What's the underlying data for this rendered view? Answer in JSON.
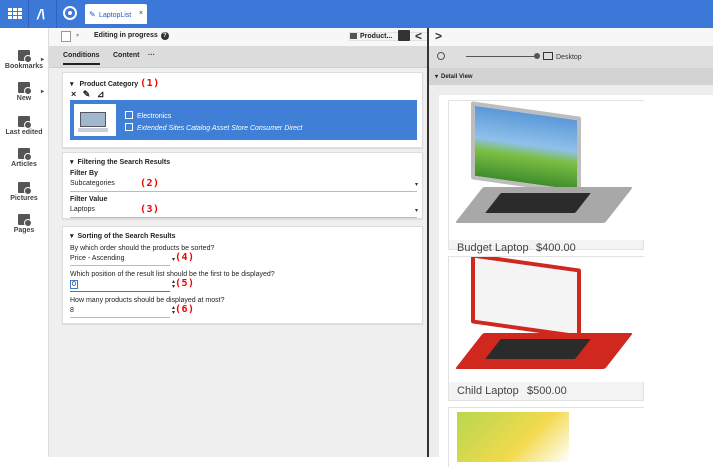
{
  "topbar": {
    "tab_label": "LaptopList",
    "tab_close": "×",
    "bg_color": "#3c78d8"
  },
  "sidebar": {
    "items": [
      {
        "label": "Bookmarks",
        "icon": "bookmarks-icon",
        "has_submenu": true
      },
      {
        "label": "New",
        "icon": "new-icon",
        "has_submenu": true
      },
      {
        "label": "Last edited",
        "icon": "last-edited-icon"
      },
      {
        "label": "Articles",
        "icon": "articles-icon"
      },
      {
        "label": "Pictures",
        "icon": "pictures-icon"
      },
      {
        "label": "Pages",
        "icon": "pages-icon"
      }
    ]
  },
  "editor": {
    "status": "Editing in progress",
    "help_glyph": "?",
    "product_button": "Product...",
    "collapse_glyph": "<",
    "tabs": [
      "Conditions",
      "Content",
      "···"
    ],
    "active_tab": "Conditions"
  },
  "product_category": {
    "title": "Product Category",
    "marker": "(1)",
    "actions": [
      "×",
      "✎",
      "⊿"
    ],
    "selected": {
      "name": "Electronics",
      "catalog": "Extended Sites Catalog Asset Store Consumer Direct"
    },
    "selection_color": "#3f7fd6"
  },
  "filtering": {
    "title": "Filtering the Search Results",
    "filter_by_label": "Filter By",
    "filter_by_value": "Subcategories",
    "filter_by_marker": "(2)",
    "filter_value_label": "Filter Value",
    "filter_value_value": "Laptops",
    "filter_value_marker": "(3)"
  },
  "sorting": {
    "title": "Sorting of the Search Results",
    "order_question": "By which order should the products be sorted?",
    "order_value": "Price - Ascending",
    "order_marker": "(4)",
    "position_question": "Which position of the result list should be the first to be displayed?",
    "position_value": "0",
    "position_marker": "(5)",
    "max_question": "How many products should be displayed at most?",
    "max_value": "8",
    "max_marker": "(6)"
  },
  "preview": {
    "nav_glyph": ">",
    "device_label": "Desktop",
    "detail_view": "Detail View",
    "products": [
      {
        "name": "Budget Laptop",
        "price": "$400.00",
        "color": "#9a9a9a"
      },
      {
        "name": "Child Laptop",
        "price": "$500.00",
        "color": "#d0281e"
      },
      {
        "name": "",
        "price": "",
        "color": "#c8d86b"
      }
    ]
  }
}
